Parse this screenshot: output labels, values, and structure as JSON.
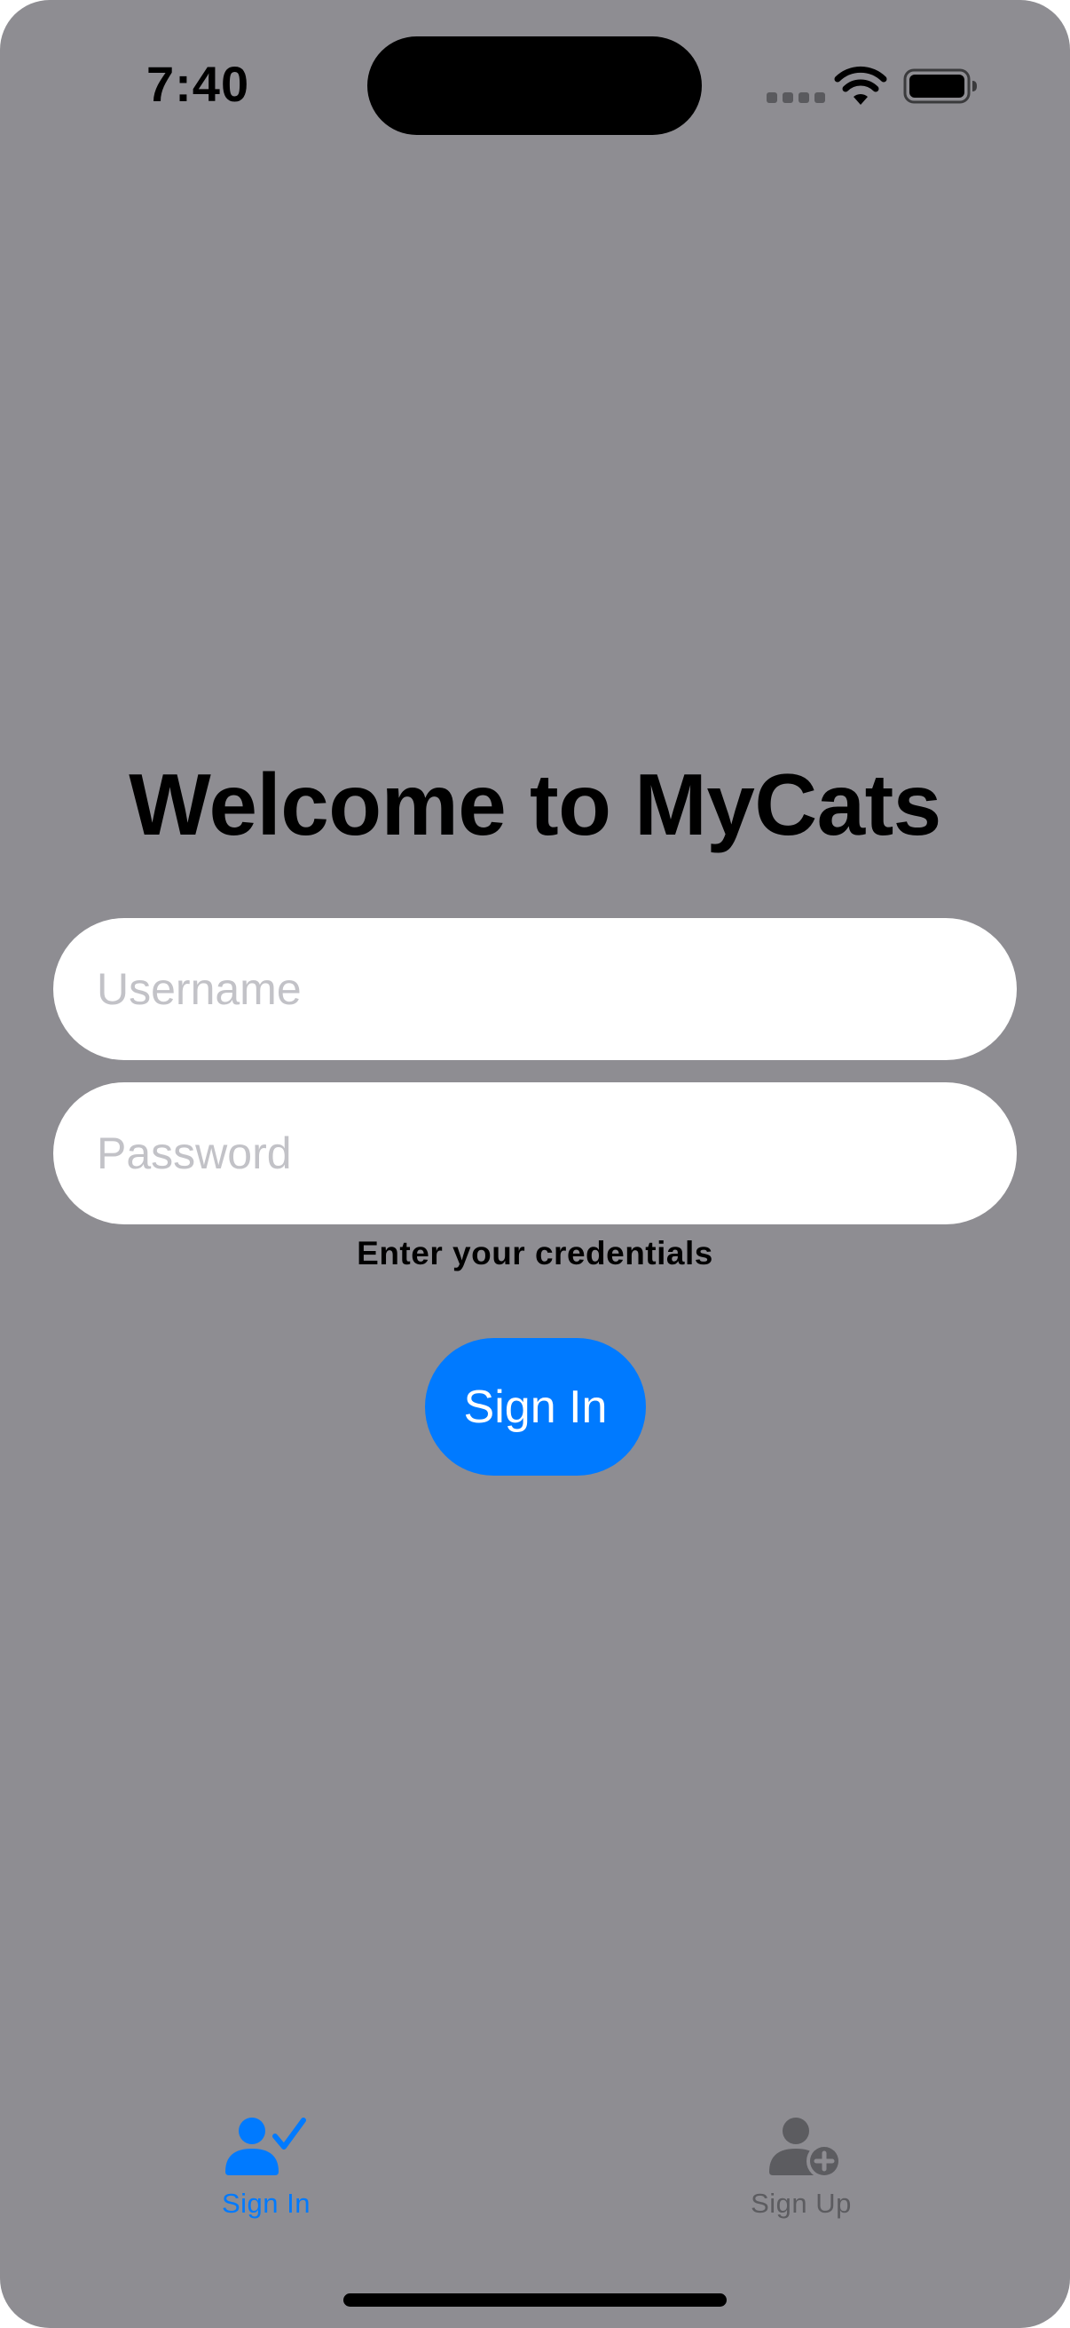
{
  "status_bar": {
    "time": "7:40"
  },
  "main": {
    "title": "Welcome to MyCats",
    "username_placeholder": "Username",
    "password_placeholder": "Password",
    "hint": "Enter your credentials",
    "sign_in_label": "Sign In"
  },
  "tab_bar": {
    "items": [
      {
        "label": "Sign In",
        "icon": "person-checkmark-icon",
        "selected": true
      },
      {
        "label": "Sign Up",
        "icon": "person-add-icon",
        "selected": false
      }
    ]
  },
  "colors": {
    "background": "#8e8d92",
    "accent": "#007aff",
    "inactive_tab": "#5c5c60",
    "field_background": "#ffffff",
    "placeholder": "#c2c2c7"
  }
}
